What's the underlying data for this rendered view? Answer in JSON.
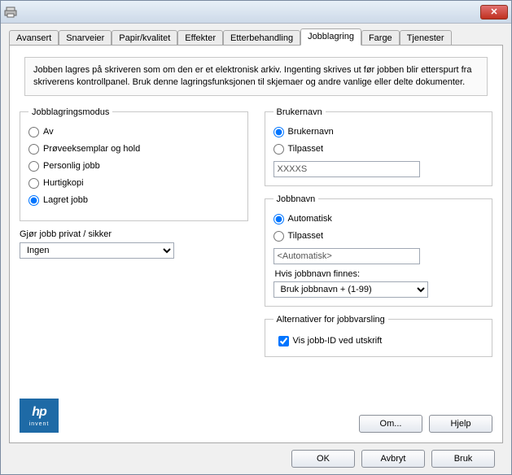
{
  "tabs": {
    "t0": "Avansert",
    "t1": "Snarveier",
    "t2": "Papir/kvalitet",
    "t3": "Effekter",
    "t4": "Etterbehandling",
    "t5": "Jobblagring",
    "t6": "Farge",
    "t7": "Tjenester"
  },
  "info_text": "Jobben lagres på skriveren som om den er et elektronisk arkiv. Ingenting skrives ut før jobben blir etterspurt fra skriverens kontrollpanel. Bruk denne lagringsfunksjonen til skjemaer og andre vanlige eller delte dokumenter.",
  "storage_mode": {
    "legend": "Jobblagringsmodus",
    "off": "Av",
    "proof": "Prøveeksemplar og hold",
    "personal": "Personlig jobb",
    "quick": "Hurtigkopi",
    "stored": "Lagret jobb"
  },
  "private": {
    "label": "Gjør jobb privat / sikker",
    "value": "Ingen"
  },
  "username": {
    "legend": "Brukernavn",
    "opt_user": "Brukernavn",
    "opt_custom": "Tilpasset",
    "value": "XXXXS"
  },
  "jobname": {
    "legend": "Jobbnavn",
    "opt_auto": "Automatisk",
    "opt_custom": "Tilpasset",
    "value": "<Automatisk>",
    "exists_label": "Hvis jobbnavn finnes:",
    "exists_value": "Bruk jobbnavn + (1-99)"
  },
  "notify": {
    "legend": "Alternativer for jobbvarsling",
    "show_id": "Vis jobb-ID ved utskrift"
  },
  "logo": {
    "brand": "hp",
    "sub": "invent"
  },
  "buttons": {
    "about": "Om...",
    "help": "Hjelp",
    "ok": "OK",
    "cancel": "Avbryt",
    "apply": "Bruk"
  }
}
